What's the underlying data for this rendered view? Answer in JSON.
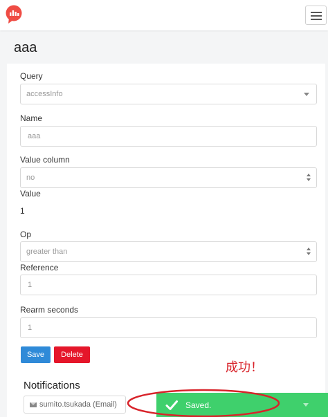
{
  "header": {
    "logo_icon": "redash-logo-icon",
    "menu_icon": "hamburger-icon"
  },
  "page": {
    "title": "aaa"
  },
  "form": {
    "query": {
      "label": "Query",
      "value": "accessInfo"
    },
    "name": {
      "label": "Name",
      "value": "aaa"
    },
    "value_column": {
      "label": "Value column",
      "value": "no"
    },
    "value": {
      "label": "Value",
      "value": "1"
    },
    "op": {
      "label": "Op",
      "value": "greater than"
    },
    "reference": {
      "label": "Reference",
      "value": "1"
    },
    "rearm": {
      "label": "Rearm seconds",
      "value": "1"
    },
    "save_label": "Save",
    "delete_label": "Delete"
  },
  "notifications": {
    "title": "Notifications",
    "items": [
      {
        "text": "sumito.tsukada (Email)"
      }
    ]
  },
  "toast": {
    "text": "Saved."
  },
  "annotation": {
    "text": "成功！"
  },
  "colors": {
    "save": "#2f8ad8",
    "delete": "#e5162a",
    "toast": "#3fd06c",
    "annotation": "#d8232a",
    "logo": "#ef4c44"
  }
}
